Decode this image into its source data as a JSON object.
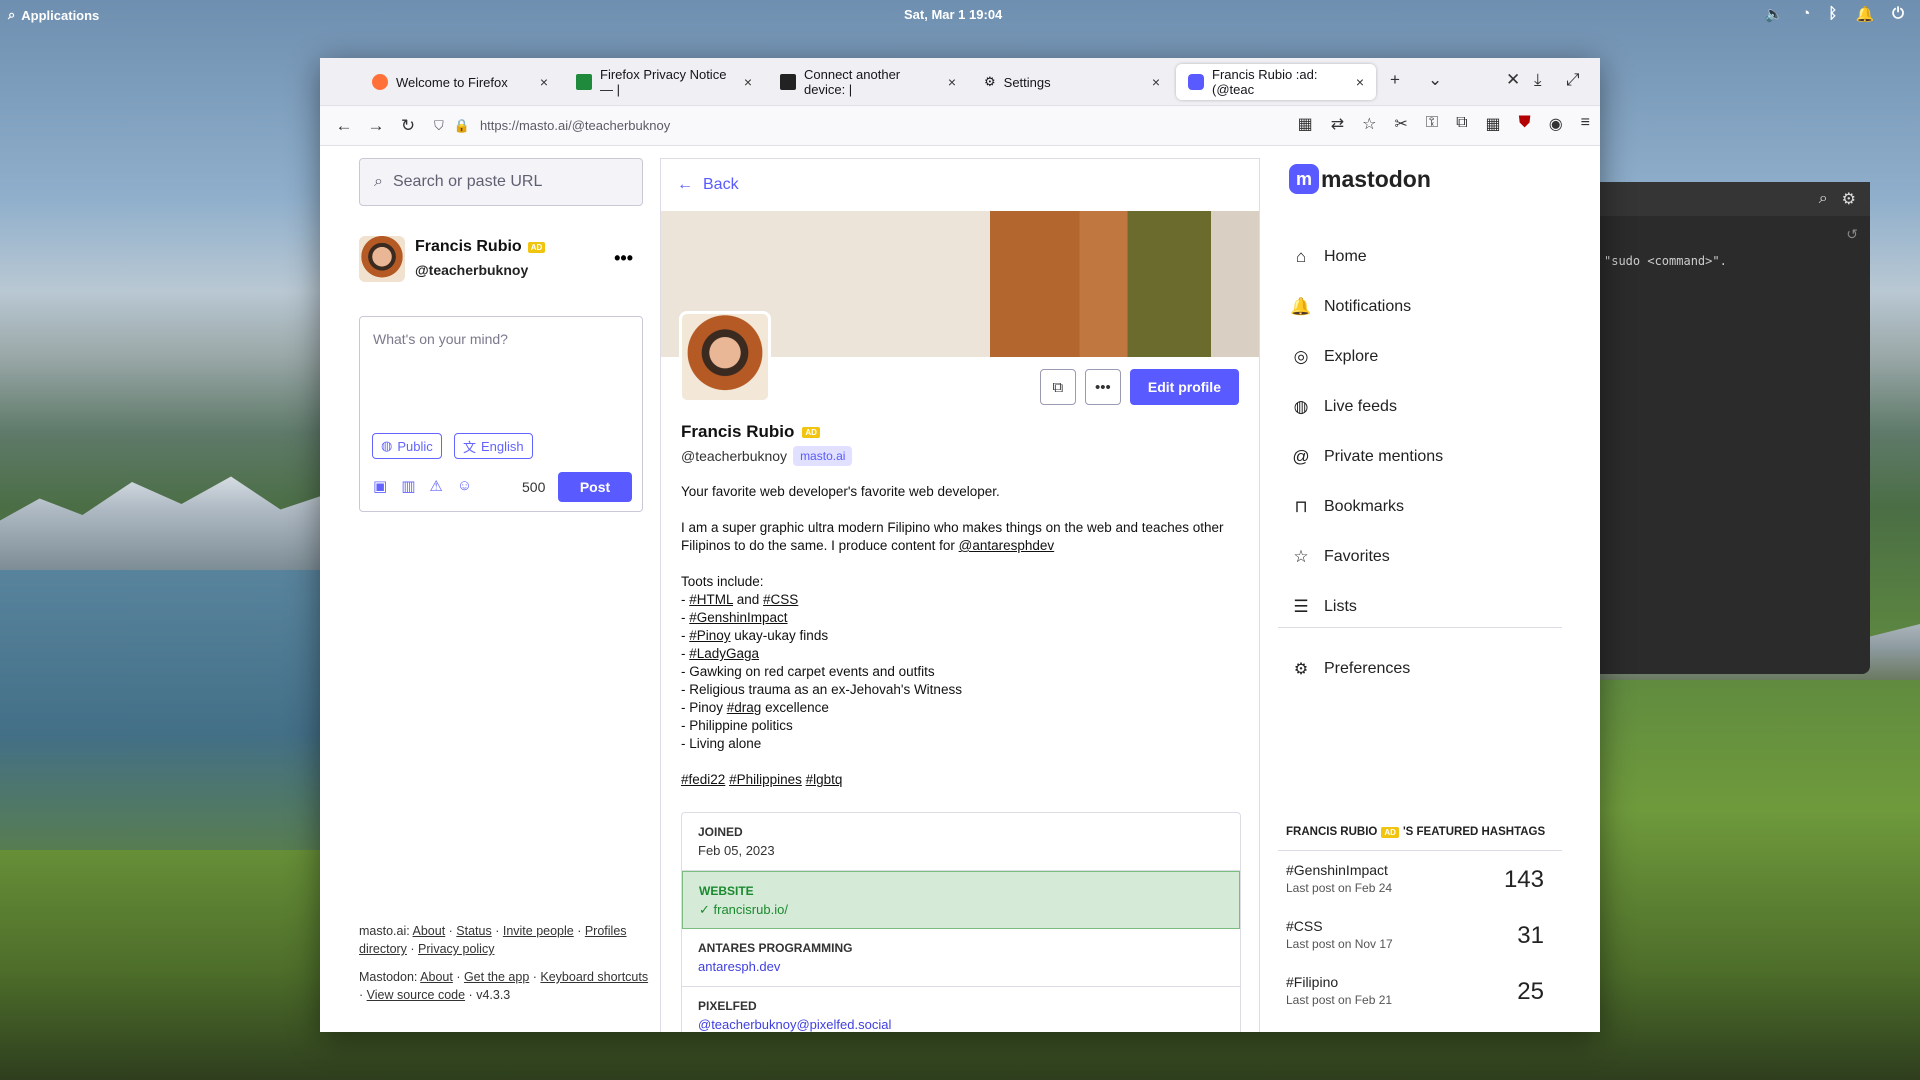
{
  "desktop": {
    "apps_label": "Applications",
    "clock": "Sat, Mar  1  19:04"
  },
  "terminal": {
    "text": "\"sudo <command>\"."
  },
  "browser": {
    "tabs": [
      {
        "label": "Welcome to Firefox",
        "color": "#ff7139"
      },
      {
        "label": "Firefox Privacy Notice — |",
        "color": "#1f8a3b"
      },
      {
        "label": "Connect another device: |",
        "color": "#222222"
      },
      {
        "label": "Settings",
        "color": "#555555"
      },
      {
        "label": "Francis Rubio :ad: (@teac",
        "color": "#595aff"
      }
    ],
    "url": "https://masto.ai/@teacherbuknoy"
  },
  "left": {
    "search_placeholder": "Search or paste URL",
    "user_name": "Francis Rubio",
    "user_handle": "@teacherbuknoy",
    "bot_badge": "AD",
    "compose_placeholder": "What's on your mind?",
    "visibility": "Public",
    "language": "English",
    "char_count": "500",
    "post_label": "Post",
    "footer": {
      "site": "masto.ai",
      "links1": [
        "About",
        "Status",
        "Invite people",
        "Profiles directory",
        "Privacy policy"
      ],
      "app": "Mastodon",
      "links2": [
        "About",
        "Get the app",
        "Keyboard shortcuts",
        "View source code"
      ],
      "version": "v4.3.3"
    }
  },
  "profile": {
    "back_label": "Back",
    "edit_label": "Edit profile",
    "name": "Francis Rubio",
    "handle": "@teacherbuknoy",
    "domain": "masto.ai",
    "bio_line1": "Your favorite web developer's favorite web developer.",
    "bio_p2a": "I am a super graphic ultra modern Filipino who makes things on the web and teaches other Filipinos to do the same. I produce content for ",
    "bio_p2_link": "@antaresphdev",
    "toots_header": "Toots include:",
    "toots_html": "#HTML",
    "toots_and": " and ",
    "toots_css": "#CSS",
    "toots_genshin": "#GenshinImpact",
    "toots_pinoy": "#Pinoy",
    "toots_pinoy_rest": " ukay-ukay finds",
    "toots_gaga": "#LadyGaga",
    "toots_carpet": "- Gawking on red carpet events and outfits",
    "toots_trauma": "- Religious trauma as an ex-Jehovah's Witness",
    "toots_drag_pre": "- Pinoy ",
    "toots_drag": "#drag",
    "toots_drag_rest": " excellence",
    "toots_politics": "- Philippine politics",
    "toots_alone": "- Living alone",
    "tags": [
      "#fedi22",
      "#Philippines",
      "#lgbtq"
    ],
    "fields": [
      {
        "key": "JOINED",
        "value": "Feb 05, 2023"
      },
      {
        "key": "WEBSITE",
        "value": "francisrub.io/"
      },
      {
        "key": "ANTARES PROGRAMMING",
        "value": "antaresph.dev"
      },
      {
        "key": "PIXELFED",
        "value": "@teacherbuknoy@pixelfed.social"
      }
    ]
  },
  "right": {
    "logo": "mastodon",
    "nav": [
      "Home",
      "Notifications",
      "Explore",
      "Live feeds",
      "Private mentions",
      "Bookmarks",
      "Favorites",
      "Lists"
    ],
    "preferences": "Preferences",
    "featured_prefix": "FRANCIS RUBIO",
    "featured_suffix": "'S FEATURED HASHTAGS",
    "hashtags": [
      {
        "name": "#GenshinImpact",
        "last": "Last post on Feb 24",
        "count": "143"
      },
      {
        "name": "#CSS",
        "last": "Last post on Nov 17",
        "count": "31"
      },
      {
        "name": "#Filipino",
        "last": "Last post on Feb 21",
        "count": "25"
      }
    ]
  },
  "colors": {
    "accent": "#595aff",
    "verified": "#1b8a2f"
  }
}
